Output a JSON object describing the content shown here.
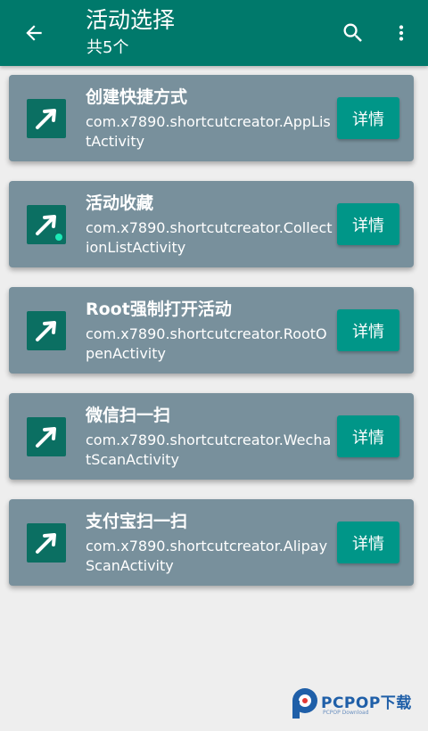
{
  "appbar": {
    "title": "活动选择",
    "subtitle": "共5个",
    "back_icon": "arrow-back-icon",
    "search_icon": "search-icon",
    "more_icon": "more-vert-icon",
    "color": "#00796b"
  },
  "activities": [
    {
      "title": "创建快捷方式",
      "package": "com.x7890.shortcutcreator.AppListActivity",
      "detail_label": "详情",
      "icon": "shortcut-arrow-icon"
    },
    {
      "title": "活动收藏",
      "package": "com.x7890.shortcutcreator.CollectionListActivity",
      "detail_label": "详情",
      "icon": "shortcut-arrow-icon"
    },
    {
      "title": "Root强制打开活动",
      "package": "com.x7890.shortcutcreator.RootOpenActivity",
      "detail_label": "详情",
      "icon": "shortcut-arrow-icon"
    },
    {
      "title": "微信扫一扫",
      "package": "com.x7890.shortcutcreator.WechatScanActivity",
      "detail_label": "详情",
      "icon": "shortcut-arrow-icon"
    },
    {
      "title": "支付宝扫一扫",
      "package": "com.x7890.shortcutcreator.AlipayScanActivity",
      "detail_label": "详情",
      "icon": "shortcut-arrow-icon"
    }
  ],
  "colors": {
    "card": "#78909c",
    "button": "#009688",
    "icon_bg": "#0b6f62"
  },
  "watermark": {
    "brand": "PCPOP下载",
    "small": "PCPOP Download"
  }
}
